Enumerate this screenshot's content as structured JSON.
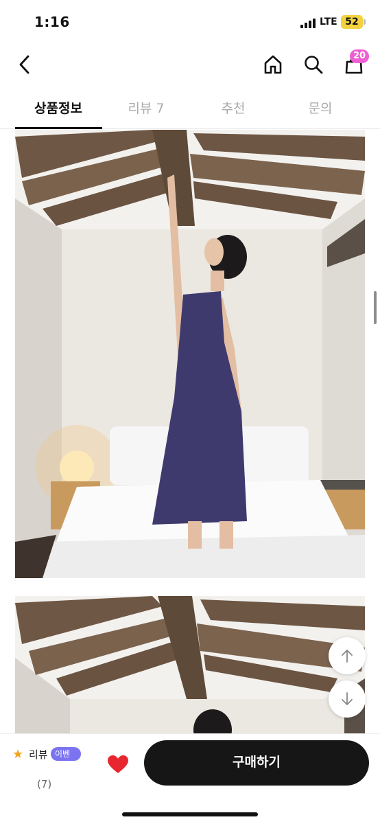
{
  "status_bar": {
    "time": "1:16",
    "network": "LTE",
    "battery": "52",
    "battery_color": "#f2d23e"
  },
  "header": {
    "back_icon": "chevron-left-icon",
    "home_icon": "home-icon",
    "search_icon": "search-icon",
    "bag_icon": "shopping-bag-icon",
    "cart_count": "20",
    "cart_badge_color": "#ef5fd3"
  },
  "tabs": [
    {
      "label": "상품정보",
      "active": true
    },
    {
      "label": "리뷰 7",
      "active": false
    },
    {
      "label": "추천",
      "active": false
    },
    {
      "label": "문의",
      "active": false
    }
  ],
  "product_images": [
    {
      "description_icon": "product-photo"
    },
    {
      "description_icon": "product-photo"
    }
  ],
  "floating_buttons": {
    "up_icon": "arrow-up-icon",
    "down_icon": "arrow-down-icon"
  },
  "bottom_bar": {
    "review_label": "리뷰",
    "event_badge": "이벤트",
    "event_badge_color": "#7b73f0",
    "review_count": "(7)",
    "star_color": "#f4a51c",
    "heart_color": "#e8262f",
    "buy_label": "구매하기"
  }
}
